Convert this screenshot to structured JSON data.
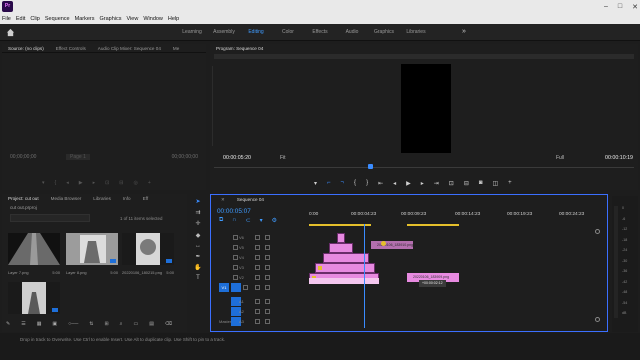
{
  "app": {
    "icon_text": "Pr"
  },
  "menu": [
    "File",
    "Edit",
    "Clip",
    "Sequence",
    "Markers",
    "Graphics",
    "View",
    "Window",
    "Help"
  ],
  "workspaces": {
    "tabs": [
      "Learning",
      "Assembly",
      "Editing",
      "Color",
      "Effects",
      "Audio",
      "Graphics",
      "Libraries"
    ],
    "active": "Editing",
    "more": "»"
  },
  "source_panel": {
    "tabs": [
      "Source: (no clips)",
      "Effect Controls",
      "Audio Clip Mixer: Sequence 04",
      "Me"
    ],
    "timecode_left": "00;00;00;00",
    "page": "Page 1",
    "timecode_right": "00;00;00;00"
  },
  "program_panel": {
    "title": "Program: Sequence 04",
    "timecode": "00:00:05:20",
    "fit": "Fit",
    "quality": "Full",
    "duration": "00:00:10:19",
    "playhead_fraction": 0.38
  },
  "project_panel": {
    "tabs": [
      "Project: cut out",
      "Media Browser",
      "Libraries",
      "Info",
      "Eff"
    ],
    "file": "cut out.prproj",
    "selection": "1 of 11 items selected",
    "items": [
      {
        "name": "Layer 7.png",
        "duration": "5:00"
      },
      {
        "name": "Layer 8.png",
        "duration": "5:00"
      },
      {
        "name": "20220106_180215.png",
        "duration": "5:00"
      },
      {
        "name": "",
        "duration": ""
      }
    ]
  },
  "timeline": {
    "tab": "Sequence 04",
    "timecode": "00:00:05:07",
    "ruler": [
      "0:00",
      "00:00:04:23",
      "00:00:09:23",
      "00:00:14:23",
      "00:00:19:23",
      "00:00:24:23"
    ],
    "tracks_video": [
      "V6",
      "V5",
      "V4",
      "V3",
      "V2",
      "V1"
    ],
    "tracks_audio": [
      "A1",
      "A2",
      "A3"
    ],
    "master": "Master",
    "master_value": "0.0",
    "drag_clip_label": "20220106_183910.png",
    "drag_clip2_label": "20220106_183909.png",
    "drag_tooltip": "+00:00:02:12",
    "v1_label": "V1"
  },
  "meter_ticks": [
    "0",
    "-6",
    "-12",
    "-18",
    "-24",
    "-30",
    "-36",
    "-42",
    "-48",
    "-54",
    "dB"
  ],
  "status": "Drop in track to Overwrite. Use Ctrl to enable Insert. Use Alt to duplicate clip. Use Shift to pin to a track.",
  "colors": {
    "accent": "#3a8cff",
    "clip": "#e78ae0",
    "marker": "#e4bf2b"
  }
}
